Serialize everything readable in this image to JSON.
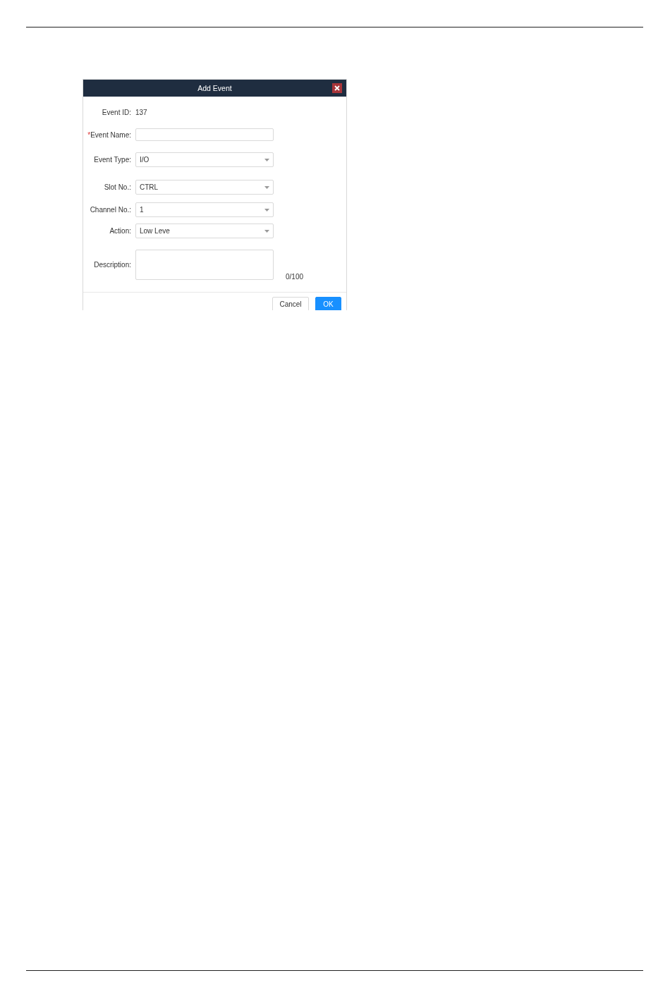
{
  "dialog": {
    "title": "Add Event",
    "fields": [
      {
        "kind": "text",
        "label": "Event ID:",
        "value": "137"
      },
      {
        "kind": "input",
        "label": "Event Name:",
        "required_mark": "*"
      },
      {
        "kind": "select",
        "label": "Event Type:",
        "value": "I/O"
      },
      {
        "kind": "select",
        "label": "Slot No.:",
        "value": "CTRL"
      },
      {
        "kind": "select",
        "label": "Channel No.:",
        "value": "1"
      },
      {
        "kind": "select",
        "label": "Action:",
        "value": "Low Leve"
      },
      {
        "kind": "textarea",
        "label": "Description:",
        "counter": "0/100"
      }
    ],
    "buttons": [
      {
        "label": "Cancel",
        "primary": false
      },
      {
        "label": "OK",
        "primary": true
      }
    ]
  }
}
